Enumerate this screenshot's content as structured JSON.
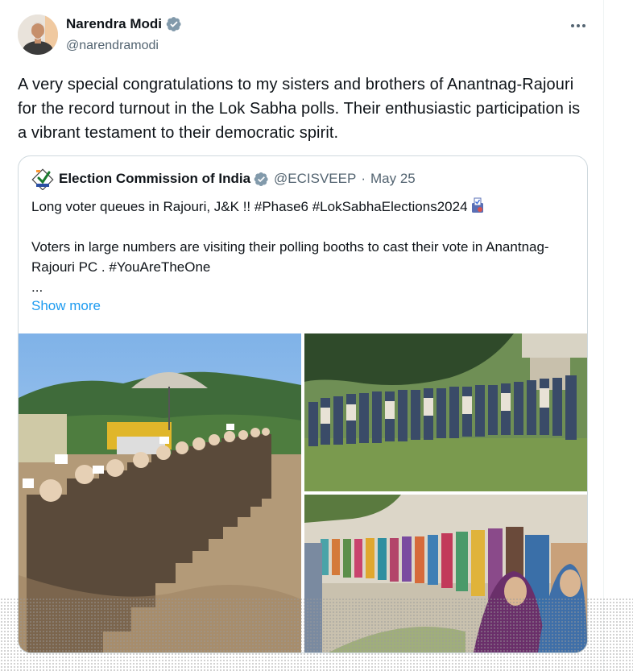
{
  "tweet": {
    "author_name": "Narendra Modi",
    "author_handle": "@narendramodi",
    "text": "A very special congratulations to my sisters and brothers of Anantnag-Rajouri for the record turnout in the Lok Sabha polls. Their enthusiastic participation is a vibrant testament to their democratic spirit."
  },
  "quoted": {
    "author_name": "Election Commission of India",
    "author_handle": "@ECISVEEP",
    "separator": "·",
    "date": "May 25",
    "line1": "Long voter queues in Rajouri, J&K !! #Phase6 #LokSabhaElections2024",
    "line2": "Voters in large numbers are visiting their polling booths to cast their vote in Anantnag-Rajouri PC . #YouAreTheOne",
    "ellipsis": "...",
    "show_more": "Show more"
  },
  "icons": {
    "verified": "verified-badge-icon",
    "more": "more-options-icon",
    "ballot": "ballot-box-icon",
    "eci_logo": "eci-logo"
  },
  "colors": {
    "verified": "#829aab",
    "link": "#1d9bf0",
    "secondary_text": "#536471",
    "border": "#cfd9de"
  }
}
